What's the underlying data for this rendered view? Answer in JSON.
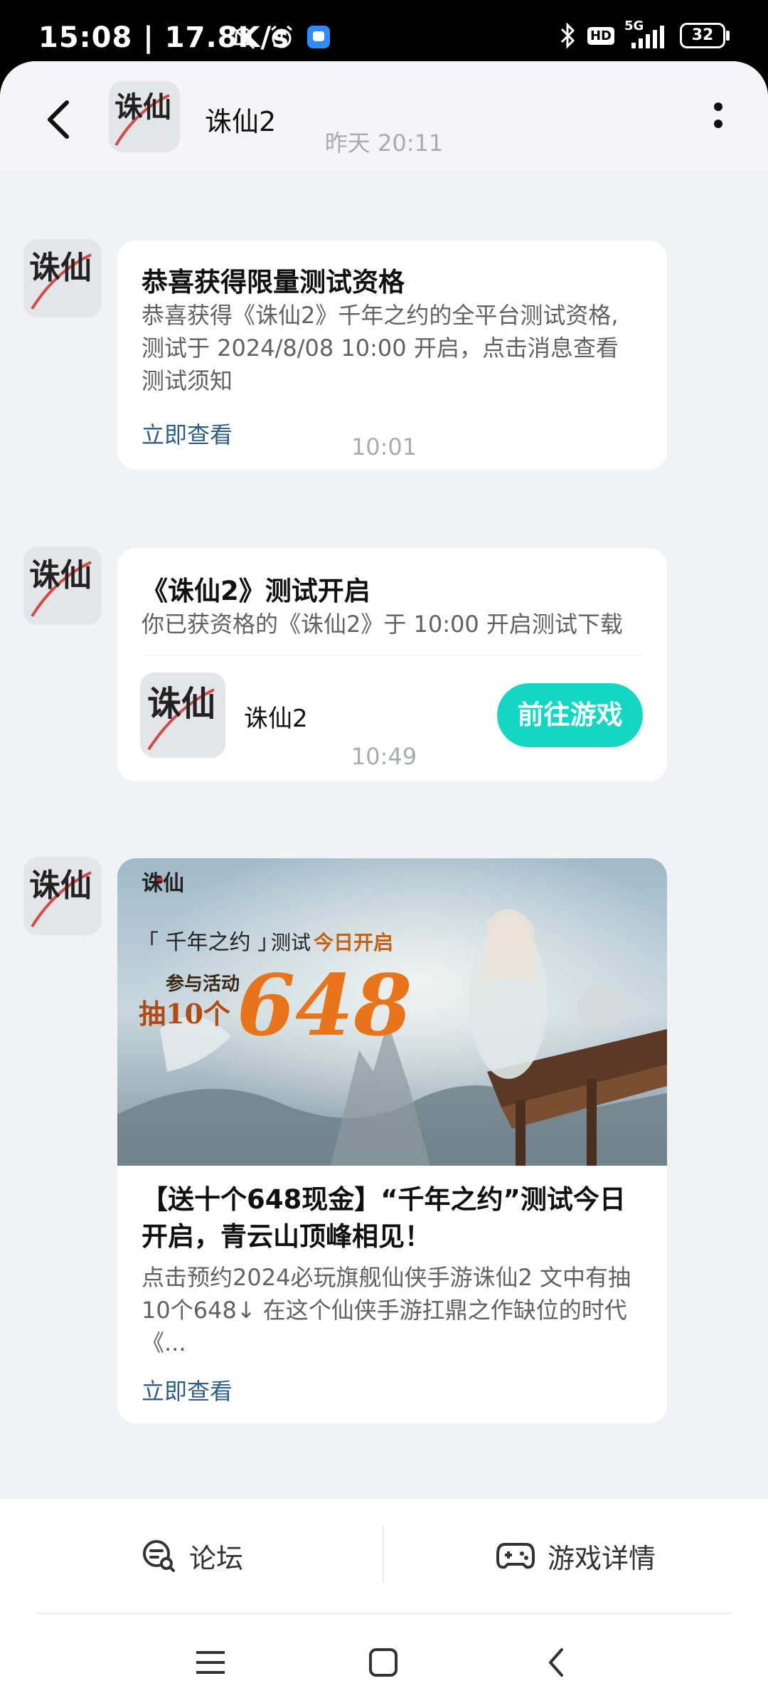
{
  "status_bar": {
    "time": "15:08",
    "speed": "17.8K/s",
    "battery": "32",
    "network": "5G",
    "hd": "HD"
  },
  "header": {
    "title": "诛仙2",
    "back_icon": "chevron-left-icon",
    "more_icon": "more-vertical-icon"
  },
  "logo_text": "诛仙",
  "messages": [
    {
      "timestamp": "昨天   20:11",
      "title": "恭喜获得限量测试资格",
      "body_lines": [
        "恭喜获得《诛仙2》千年之约的全平台测试资格,",
        "测试于 2024/8/08 10:00 开启，点击消息查看",
        "测试须知"
      ],
      "link": "立即查看"
    },
    {
      "timestamp": "10:01",
      "title": "《诛仙2》测试开启",
      "body": "你已获资格的《诛仙2》于 10:00 开启测试下载",
      "game_name": "诛仙2",
      "button": "前往游戏"
    },
    {
      "timestamp": "10:49",
      "banner": {
        "logo": "诛仙",
        "line1_a": "「 千年之约 」",
        "line1_b": "测试",
        "line1_c": "今日开启",
        "line2": "参与活动",
        "line3": "抽10个",
        "big_number": "648"
      },
      "title_lines": [
        "【送十个648现金】“千年之约”测试今日",
        "开启，青云山顶峰相见！"
      ],
      "body_lines": [
        "点击预约2024必玩旗舰仙侠手游诛仙2 文中有抽",
        "10个648↓ 在这个仙侠手游扛鼎之作缺位的时代",
        "《..."
      ],
      "link": "立即查看"
    }
  ],
  "bottom_tabs": [
    {
      "label": "论坛",
      "icon": "forum-icon"
    },
    {
      "label": "游戏详情",
      "icon": "gamepad-icon"
    }
  ],
  "colors": {
    "accent": "#15d6c1",
    "link": "#2d5d86",
    "background": "#f1f2f4"
  }
}
